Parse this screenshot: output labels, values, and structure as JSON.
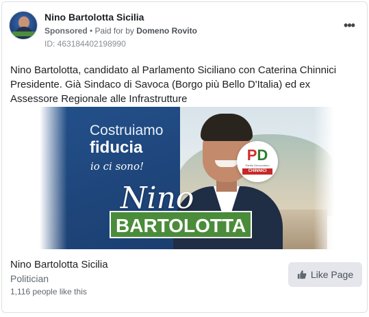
{
  "header": {
    "page_name": "Nino Bartolotta Sicilia",
    "sponsored": "Sponsored",
    "separator": " • ",
    "paid_for_by": "Paid for by ",
    "payer": "Domeno Rovito",
    "ad_id": "ID: 463184402198990",
    "more_label": "•••"
  },
  "post": {
    "text": "Nino Bartolotta, candidato al Parlamento Siciliano con Caterina Chinnici Presidente. Già Sindaco di Savoca (Borgo più Bello D'Italia) ed ex Assessore Regionale alle Infrastrutture"
  },
  "creative": {
    "headline_line1": "Costruiamo",
    "headline_line2": "fiducia",
    "slogan": "io ci sono!",
    "first_name": "Nino",
    "last_name": "BARTOLOTTA",
    "party_mark_p": "P",
    "party_mark_d": "D",
    "party_subtitle": "Partito Democratico",
    "party_band": "CHINNICI"
  },
  "footer": {
    "page_title": "Nino Bartolotta Sicilia",
    "category": "Politician",
    "likes": "1,116 people like this",
    "like_button": "Like Page"
  },
  "colors": {
    "brand_blue": "#1b3e70",
    "accent_green": "#4a8c3a",
    "pd_red": "#d32f2f"
  }
}
